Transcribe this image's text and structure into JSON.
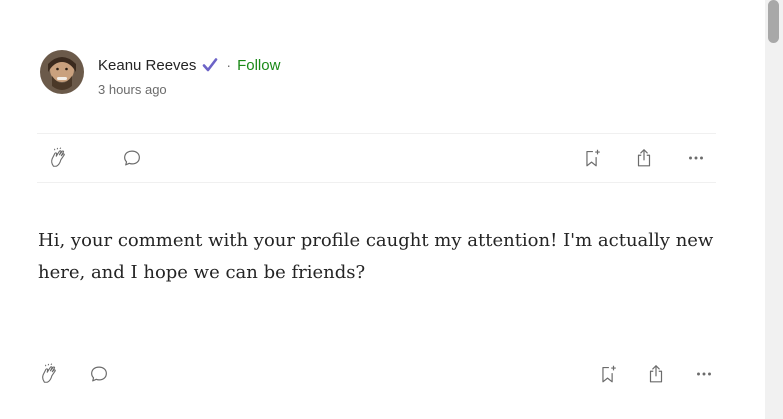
{
  "author": {
    "name": "Keanu Reeves",
    "follow_label": "Follow",
    "separator": "·",
    "timestamp": "3 hours ago"
  },
  "post": {
    "text": "Hi, your comment with your profile caught my attention! I'm actually new here, and I hope we can be friends?"
  },
  "actions": {
    "icons": [
      "clap-icon",
      "comment-icon",
      "bookmark-add-icon",
      "share-icon",
      "more-icon"
    ]
  },
  "colors": {
    "follow": "#1a8917",
    "verified": "#6c63c7",
    "muted": "#6b6b6b"
  }
}
